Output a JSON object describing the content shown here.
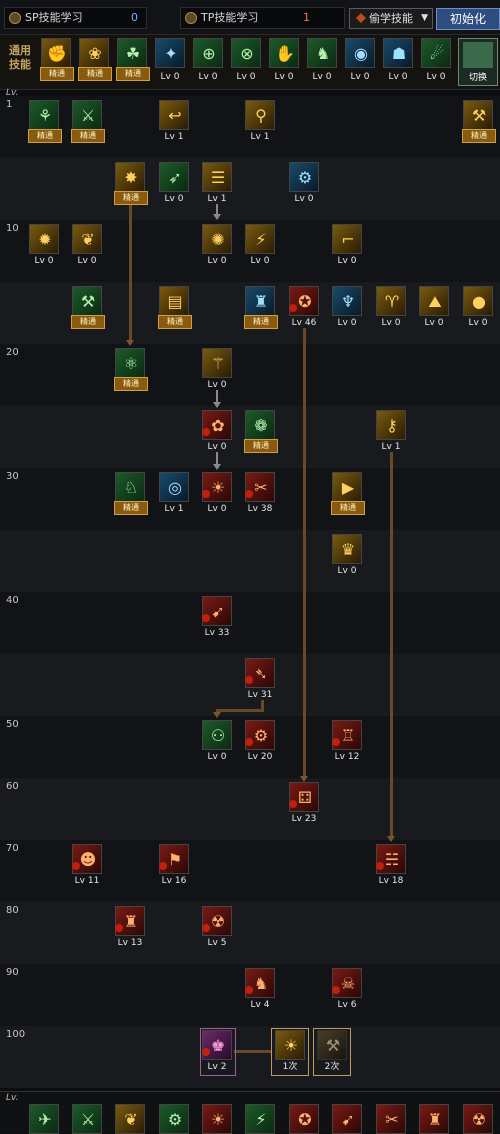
{
  "header": {
    "sp_label": "SP技能学习",
    "sp_value": "0",
    "tp_label": "TP技能学习",
    "tp_value": "1",
    "steal_label": "偷学技能",
    "reset_label": "初始化",
    "common_label_1": "通用",
    "common_label_2": "技能",
    "switch_label": "切换"
  },
  "level_header": "Lv.",
  "level_labels": [
    "1",
    "10",
    "20",
    "30",
    "40",
    "50",
    "60",
    "70",
    "80",
    "90",
    "100"
  ],
  "master_text": "精通",
  "skill_values": {
    "v0": "Lv 0",
    "v1": "Lv 1",
    "v2": "Lv 2",
    "v4": "Lv 4",
    "v5": "Lv 5",
    "v6": "Lv 6",
    "v11": "Lv 11",
    "v12": "Lv 12",
    "v13": "Lv 13",
    "v16": "Lv 16",
    "v18": "Lv 18",
    "v20": "Lv 20",
    "v23": "Lv 23",
    "v31": "Lv 31",
    "v33": "Lv 33",
    "v38": "Lv 38",
    "v46": "Lv 46",
    "first": "1次",
    "second": "2次"
  },
  "colors": {
    "accent": "#2d4d80",
    "link_line": "#6a4a26",
    "master_badge": "#8a5a10"
  }
}
